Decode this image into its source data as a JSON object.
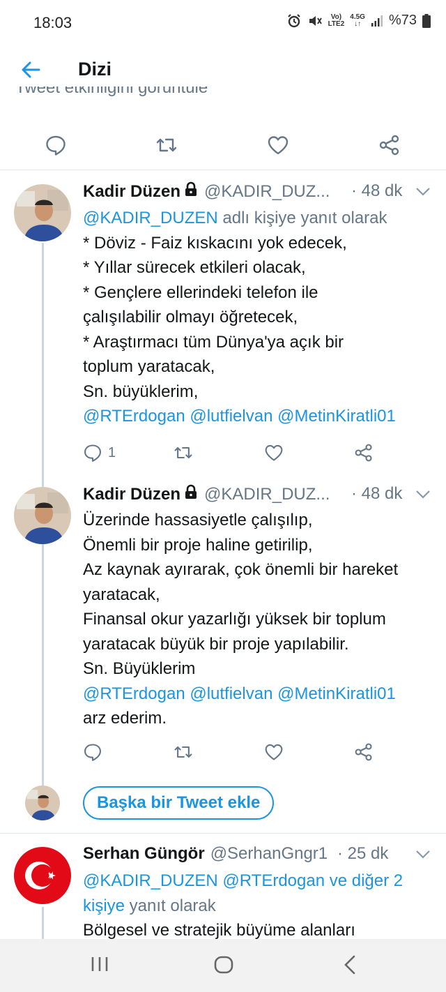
{
  "status_bar": {
    "time": "18:03",
    "network_top": "Vo)",
    "network_bottom": "LTE2",
    "net_speed_top": "4.5G",
    "battery": "%73"
  },
  "app_bar": {
    "title": "Dizi"
  },
  "top_partial": {
    "text": "Tweet etkinliğini görüntüle"
  },
  "tweets": [
    {
      "name": "Kadir Düzen",
      "handle": "@KADIR_DUZ...",
      "time": "· 48 dk",
      "reply_to_prefix": "@KADIR_DUZEN",
      "reply_to_suffix": " adlı kişiye yanıt olarak",
      "lines": [
        "* Döviz - Faiz kıskacını yok edecek,",
        "* Yıllar sürecek etkileri olacak,",
        "* Gençlere ellerindeki telefon ile",
        "çalışılabilir olmayı öğretecek,",
        "* Araştırmacı tüm Dünya'ya açık bir",
        "toplum yaratacak,",
        "Sn. büyüklerim,"
      ],
      "mentions": "@RTErdogan @lutfielvan @MetinKiratli01",
      "reply_count": "1"
    },
    {
      "name": "Kadir Düzen",
      "handle": "@KADIR_DUZ...",
      "time": "· 48 dk",
      "lines": [
        "Üzerinde hassasiyetle çalışılıp,",
        "Önemli bir proje haline getirilip,",
        "Az kaynak ayırarak, çok önemli bir hareket",
        "yaratacak,",
        "Finansal okur yazarlığı yüksek bir toplum",
        "yaratacak büyük bir proje yapılabilir.",
        "Sn. Büyüklerim"
      ],
      "mentions": "@RTErdogan @lutfielvan @MetinKiratli01",
      "closing": "arz ederim."
    },
    {
      "name": "Serhan Güngör",
      "handle": "@SerhanGngr1",
      "time": "· 25 dk",
      "reply_mentions": "@KADIR_DUZEN @RTErdogan ve diğer 2",
      "reply_mentions_2": "kişiye",
      "reply_suffix": " yanıt olarak",
      "first_line": "Bölgesel ve stratejik büyüme alanları"
    }
  ],
  "add_tweet_label": "Başka bir Tweet ekle",
  "colors": {
    "accent": "#1b95e0",
    "muted": "#657786",
    "text": "#14171a",
    "divider": "#e1e8ed"
  }
}
